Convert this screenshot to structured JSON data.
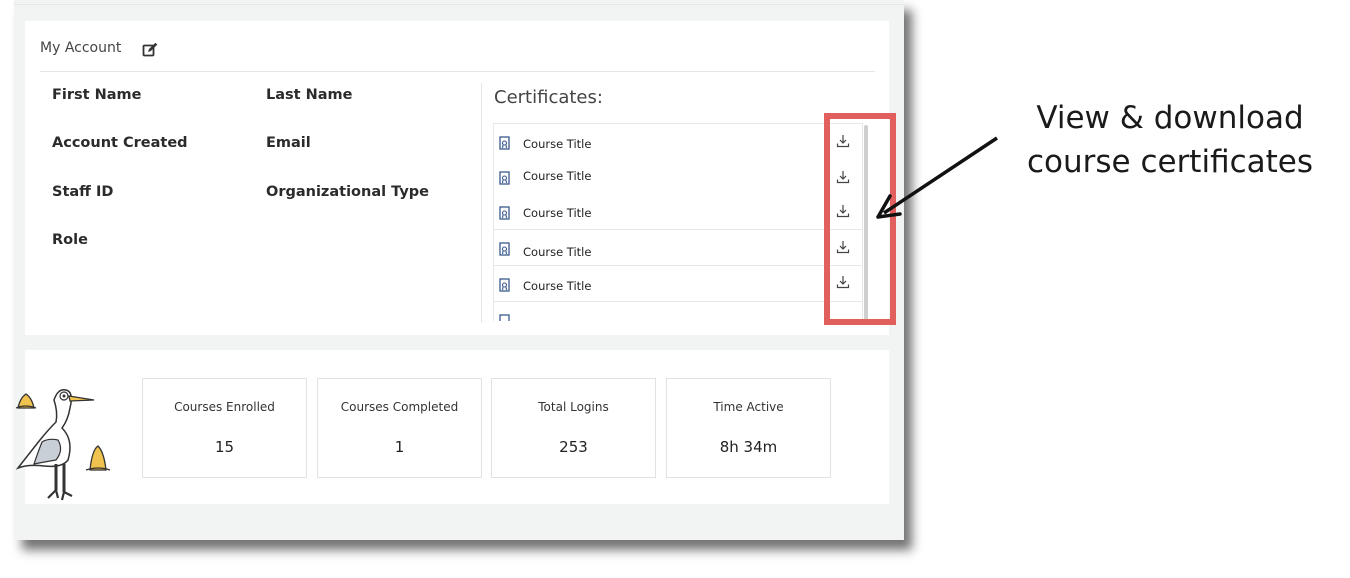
{
  "account": {
    "header": "My Account",
    "fields": {
      "first_name": "First Name",
      "last_name": "Last Name",
      "account_created": "Account Created",
      "email": "Email",
      "staff_id": "Staff ID",
      "organizational_type": "Organizational Type",
      "role": "Role"
    }
  },
  "certificates": {
    "title": "Certificates:",
    "items": [
      {
        "label": "Course Title"
      },
      {
        "label": "Course Title"
      },
      {
        "label": "Course Title"
      },
      {
        "label": "Course Title"
      },
      {
        "label": "Course Title"
      }
    ]
  },
  "stats": [
    {
      "label": "Courses Enrolled",
      "value": "15"
    },
    {
      "label": "Courses Completed",
      "value": "1"
    },
    {
      "label": "Total Logins",
      "value": "253"
    },
    {
      "label": "Time Active",
      "value": "8h 34m"
    }
  ],
  "annotation": {
    "line1": "View & download",
    "line2": "course certificates",
    "highlight_color": "#e1605d"
  }
}
